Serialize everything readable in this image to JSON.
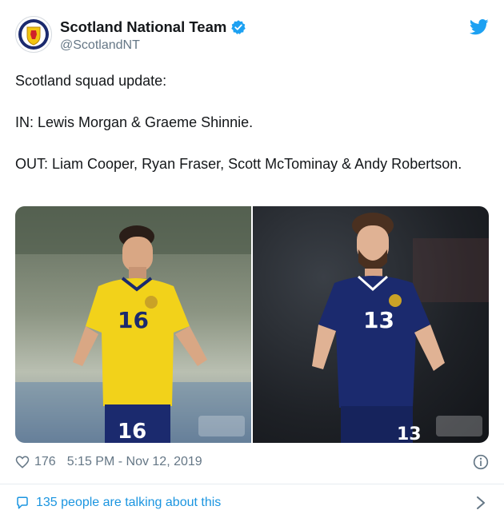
{
  "author": {
    "display_name": "Scotland National Team",
    "handle": "@ScotlandNT",
    "avatar_icon": "scotland-crest-icon",
    "verified_icon": "verified-badge-icon",
    "verified_color": "#1da1f2"
  },
  "brand": {
    "icon": "twitter-bird-icon",
    "color": "#1da1f2"
  },
  "tweet": {
    "line1": "Scotland squad update:",
    "line2": "IN: Lewis Morgan & Graeme Shinnie.",
    "line3": "OUT: Liam Cooper, Ryan Fraser, Scott McTominay & Andy Robertson."
  },
  "media": {
    "photos": [
      {
        "kit_color": "#f2d21a",
        "shirt_number": "16",
        "shorts_number": "16"
      },
      {
        "kit_color": "#1b2a6e",
        "shirt_number": "13",
        "shorts_number": "13"
      }
    ]
  },
  "meta": {
    "like_icon": "heart-icon",
    "like_count": "176",
    "timestamp": "5:15 PM - Nov 12, 2019",
    "info_icon": "info-icon"
  },
  "conversation": {
    "icon": "comment-icon",
    "label": "135 people are talking about this",
    "link_color": "#1b95e0"
  }
}
